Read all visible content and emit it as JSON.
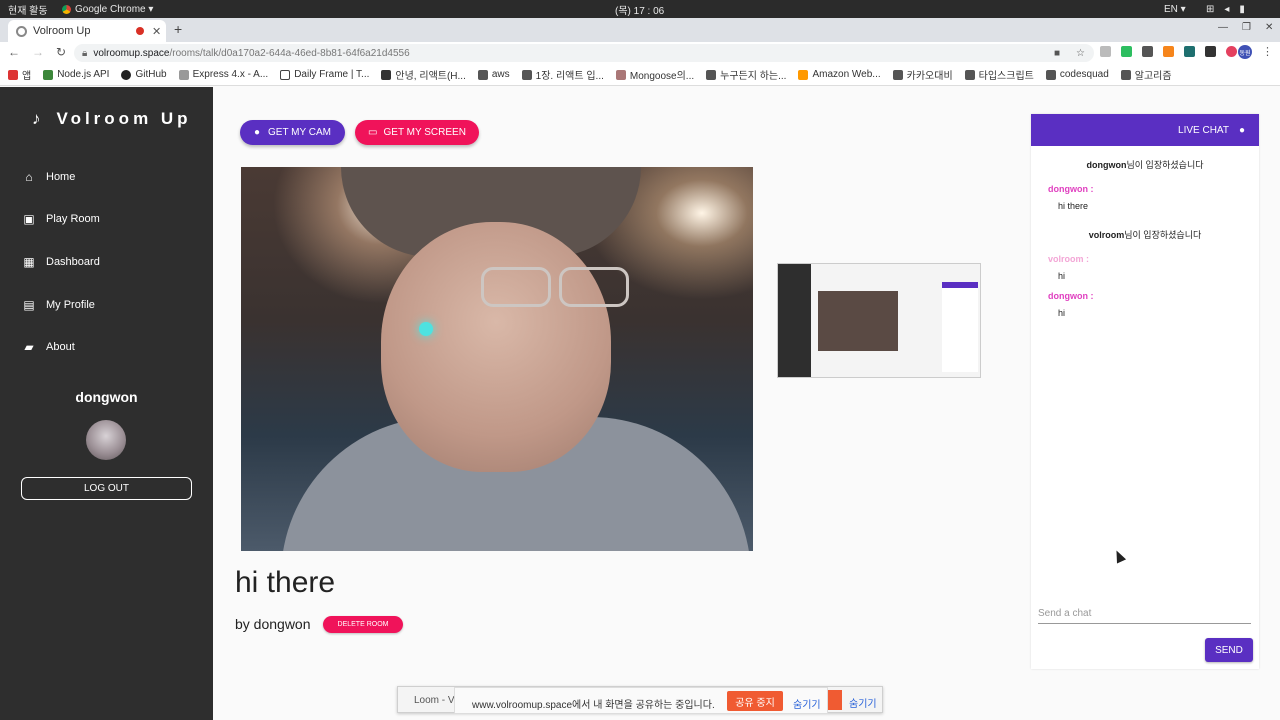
{
  "os": {
    "activities": "현재 활동",
    "app_name": "Google Chrome ▾",
    "clock": "(목) 17 : 06",
    "lang": "EN ▾"
  },
  "browser": {
    "tab_title": "Volroom Up",
    "url_host": "volroomup.space",
    "url_path": "/rooms/talk/d0a170a2-644a-46ed-8b81-64f6a21d4556",
    "bookmarks": [
      "앱",
      "Node.js API",
      "GitHub",
      "Express 4.x - A...",
      "Daily Frame | T...",
      "안녕, 리액트(H...",
      "aws",
      "1장. 리액트 입...",
      "Mongoose의...",
      "누구든지 하는...",
      "Amazon Web...",
      "카카오대비",
      "타입스크립트",
      "codesquad",
      "알고리즘"
    ],
    "profile_initials": "동원"
  },
  "sidebar": {
    "brand": "Volroom Up",
    "items": [
      {
        "label": "Home",
        "icon": "home-icon"
      },
      {
        "label": "Play Room",
        "icon": "play-room-icon"
      },
      {
        "label": "Dashboard",
        "icon": "dashboard-icon"
      },
      {
        "label": "My Profile",
        "icon": "profile-card-icon"
      },
      {
        "label": "About",
        "icon": "chat-bubble-icon"
      }
    ],
    "username": "dongwon",
    "logout_label": "LOG OUT"
  },
  "main": {
    "cam_button": "GET MY CAM",
    "screen_button": "GET MY SCREEN",
    "room_title": "hi there",
    "room_author": "by dongwon",
    "delete_button": "DELETE ROOM"
  },
  "chat": {
    "header": "LIVE CHAT",
    "messages": [
      {
        "type": "system",
        "user": "dongwon",
        "text": "님이 입장하셨습니다"
      },
      {
        "type": "user",
        "user": "dongwon :",
        "text": "hi there",
        "color": "#e040c0"
      },
      {
        "type": "system",
        "user": "volroom",
        "text": "님이 입장하셨습니다"
      },
      {
        "type": "user",
        "user": "volroom :",
        "text": "hi",
        "color": "#f3a6d6"
      },
      {
        "type": "user",
        "user": "dongwon :",
        "text": "hi",
        "color": "#e040c0"
      }
    ],
    "input_placeholder": "Send a chat",
    "send_label": "SEND"
  },
  "share_bar": {
    "loom_label": "Loom - V",
    "message": "www.volroomup.space에서 내 화면을 공유하는 중입니다.",
    "stop_label": "공유 중지",
    "hide_label": "숨기기",
    "hide_label_2": "숨기기"
  },
  "colors": {
    "purple": "#5a2fc2",
    "pink": "#f0135a",
    "sidebar": "#2e2e2e"
  }
}
